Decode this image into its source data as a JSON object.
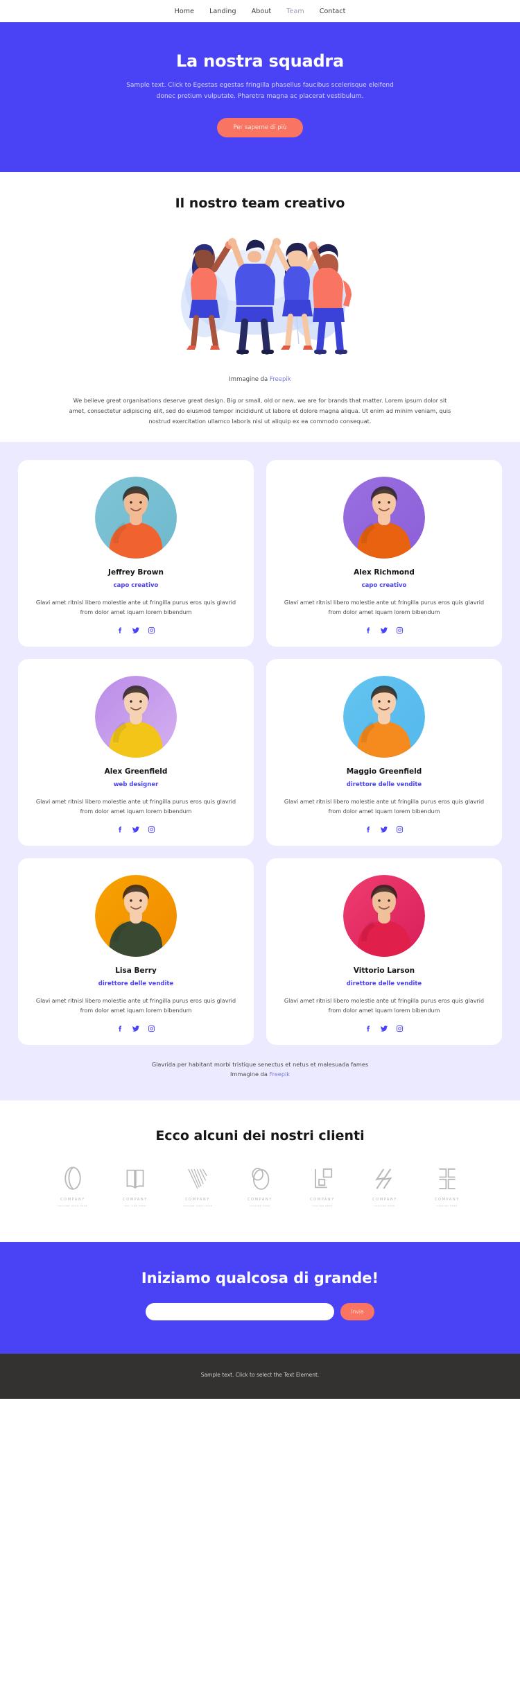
{
  "nav": {
    "items": [
      {
        "label": "Home",
        "active": false
      },
      {
        "label": "Landing",
        "active": false
      },
      {
        "label": "About",
        "active": false
      },
      {
        "label": "Team",
        "active": true
      },
      {
        "label": "Contact",
        "active": false
      }
    ]
  },
  "hero": {
    "title": "La nostra squadra",
    "description": "Sample text. Click to Egestas egestas fringilla phasellus faucibus scelerisque eleifend donec pretium vulputate. Pharetra magna ac placerat vestibulum.",
    "cta_label": "Per saperne di più",
    "bg_color": "#4a42f5",
    "cta_color": "#fa7561"
  },
  "creative": {
    "title": "Il nostro team creativo",
    "credit_prefix": "Immagine da ",
    "credit_link": "Freepik",
    "body": "We believe great organisations deserve great design. Big or small, old or new, we are for brands that matter. Lorem ipsum dolor sit amet, consectetur adipiscing elit, sed do eiusmod tempor incididunt ut labore et dolore magna aliqua. Ut enim ad minim veniam, quis nostrud exercitation ullamco laboris nisi ut aliquip ex ea commodo consequat."
  },
  "team": {
    "bio": "Glavi amet ritnisl libero molestie ante ut fringilla purus eros quis glavrid from dolor amet iquam lorem bibendum",
    "social_icons": [
      "facebook-icon",
      "twitter-icon",
      "instagram-icon"
    ],
    "accent_color": "#4a42f5",
    "members": [
      {
        "name": "Jeffrey Brown",
        "role": "capo creativo",
        "bg_from": "#7fc4d6",
        "bg_to": "#6fb9cd",
        "shirt": "#f0632f",
        "skin": "#f3bb95"
      },
      {
        "name": "Alex Richmond",
        "role": "capo creativo",
        "bg_from": "#9a6fe0",
        "bg_to": "#8c5fd8",
        "shirt": "#e8620f",
        "skin": "#f5c7a5"
      },
      {
        "name": "Alex Greenfield",
        "role": "web designer",
        "bg_from": "#b98ce8",
        "bg_to": "#d5b0f0",
        "shirt": "#f2c518",
        "skin": "#f6d2b4"
      },
      {
        "name": "Maggio Greenfield",
        "role": "direttore delle vendite",
        "bg_from": "#63c4f0",
        "bg_to": "#55b8ec",
        "shirt": "#f58a1f",
        "skin": "#f6cfae"
      },
      {
        "name": "Lisa Berry",
        "role": "direttore delle vendite",
        "bg_from": "#f7a300",
        "bg_to": "#f08a00",
        "shirt": "#3a4a32",
        "skin": "#f6ceae"
      },
      {
        "name": "Vittorio Larson",
        "role": "direttore delle vendite",
        "bg_from": "#ef3d6e",
        "bg_to": "#d81e5b",
        "shirt": "#e01f4a",
        "skin": "#f0c09a"
      }
    ],
    "footnote_line1": "Glavrida per habitant morbi tristique senectus et netus et malesuada fames",
    "footnote_prefix": "Immagine da ",
    "footnote_link": "Freepik"
  },
  "clients": {
    "title": "Ecco alcuni dei nostri clienti",
    "logos": [
      {
        "name": "COMPANY",
        "tagline": "TAGLINE GOES HERE",
        "mark": "oval-loop-mark"
      },
      {
        "name": "COMPANY",
        "tagline": "TAG LINE HERE",
        "mark": "open-book-mark"
      },
      {
        "name": "COMPANY",
        "tagline": "TAGLINE GOES HERE",
        "mark": "v-lines-mark"
      },
      {
        "name": "COMPANY",
        "tagline": "TAGLINE HERE",
        "mark": "double-ellipse-mark"
      },
      {
        "name": "COMPANY",
        "tagline": "TAGLINE HERE",
        "mark": "squares-mark"
      },
      {
        "name": "COMPANY",
        "tagline": "TAGLINE HERE",
        "mark": "slashes-mark"
      },
      {
        "name": "COMPANY",
        "tagline": "TAGLINE HERE",
        "mark": "bracket-mark"
      }
    ]
  },
  "subscribe": {
    "title": "Iniziamo qualcosa di grande!",
    "input_value": "",
    "input_placeholder": "",
    "button_label": "Invia"
  },
  "footer": {
    "text": "Sample text. Click to select the Text Element."
  }
}
